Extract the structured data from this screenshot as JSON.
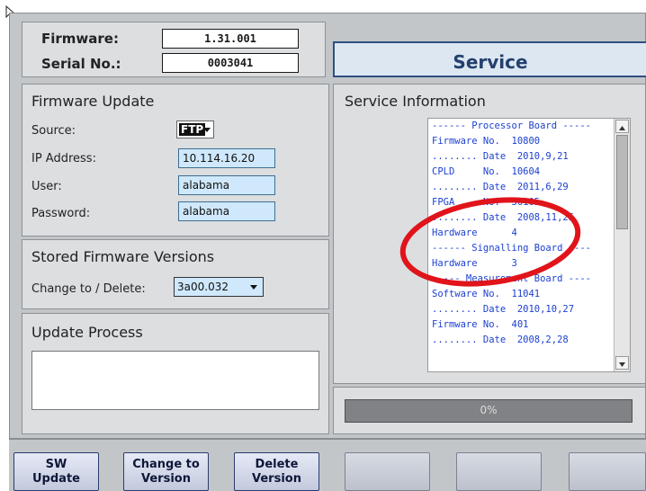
{
  "header": {
    "firmware_label": "Firmware:",
    "firmware_value": "1.31.001",
    "serial_label": "Serial No.:",
    "serial_value": "0003041",
    "service_title": "Service"
  },
  "firmware_update": {
    "title": "Firmware Update",
    "source_label": "Source:",
    "source_value": "FTP",
    "ip_label": "IP Address:",
    "ip_value": "10.114.16.20",
    "user_label": "User:",
    "user_value": "alabama",
    "password_label": "Password:",
    "password_value": "alabama"
  },
  "stored_versions": {
    "title": "Stored Firmware Versions",
    "change_label": "Change to / Delete:",
    "selected": "3a00.032"
  },
  "update_process": {
    "title": "Update Process"
  },
  "service_info": {
    "title": "Service Information",
    "lines": [
      "------ Processor Board -----",
      "Firmware No.  10800",
      "........ Date  2010,9,21",
      "CPLD     No.  10604",
      "........ Date  2011,6,29",
      "FPGA     No.  30105",
      "........ Date  2008,11,25",
      "Hardware      4",
      "------ Signalling Board ----",
      "Hardware      3",
      "----- Measurement Board ----",
      "Software No.  11041",
      "........ Date  2010,10,27",
      "Firmware No.  401",
      "........ Date  2008,2,28"
    ]
  },
  "progress": {
    "label": "0%",
    "value": 0
  },
  "buttons": {
    "sw_update": [
      "SW",
      "Update"
    ],
    "change_version": [
      "Change to",
      "Version"
    ],
    "delete_version": [
      "Delete",
      "Version"
    ]
  },
  "colors": {
    "info_text": "#1b3fd1",
    "highlight_circle": "#e0141a",
    "input_fill": "#cfe8fb",
    "service_title": "#24406d"
  }
}
